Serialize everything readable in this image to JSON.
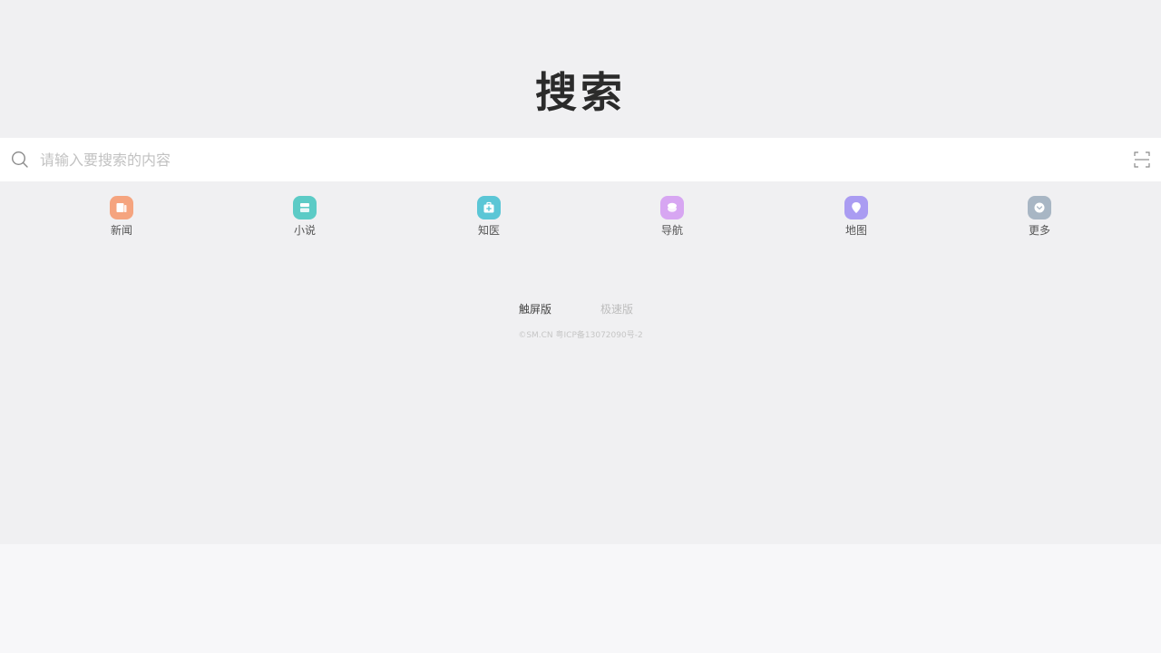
{
  "logo": {
    "text": "搜索"
  },
  "search": {
    "placeholder": "请输入要搜索的内容",
    "value": ""
  },
  "shortcuts": [
    {
      "label": "新闻",
      "color": "#f5a47f",
      "icon": "news-icon"
    },
    {
      "label": "小说",
      "color": "#5ccbc6",
      "icon": "book-icon"
    },
    {
      "label": "知医",
      "color": "#5bc6d6",
      "icon": "medical-kit-icon"
    },
    {
      "label": "导航",
      "color": "#d7a6f2",
      "icon": "navigation-icon"
    },
    {
      "label": "地图",
      "color": "#aa9cf2",
      "icon": "map-pin-icon"
    },
    {
      "label": "更多",
      "color": "#a8b6c4",
      "icon": "more-chevron-icon"
    }
  ],
  "versions": {
    "touch": "触屏版",
    "lite": "极速版"
  },
  "footer": {
    "copyright": "©SM.CN 粤ICP备13072090号-2"
  },
  "colors": {
    "page_bg": "#f0f0f2",
    "bottom_bg": "#f7f7f9",
    "logo_text": "#2b2b2b",
    "placeholder": "#c2c2c2"
  }
}
